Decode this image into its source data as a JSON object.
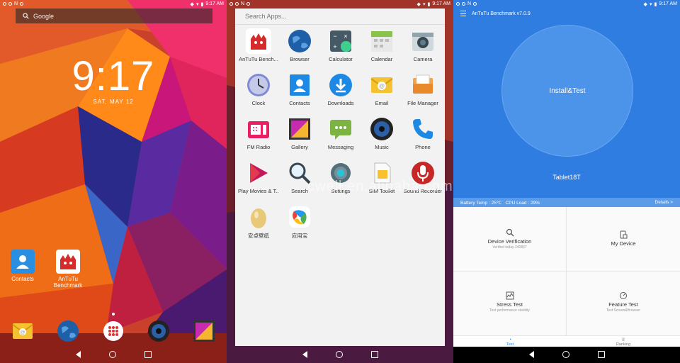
{
  "status": {
    "time": "9:17 AM"
  },
  "home": {
    "search_label": "Google",
    "clock": "9:17",
    "date": "SAT, MAY 12",
    "apps": [
      {
        "label": "Contacts"
      },
      {
        "label": "AnTuTu Benchmark"
      }
    ]
  },
  "drawer": {
    "search_placeholder": "Search Apps...",
    "apps": [
      {
        "label": "AnTuTu Bench...",
        "icon": "antutu-icon"
      },
      {
        "label": "Browser",
        "icon": "globe-icon"
      },
      {
        "label": "Calculator",
        "icon": "calculator-icon"
      },
      {
        "label": "Calendar",
        "icon": "calendar-icon"
      },
      {
        "label": "Camera",
        "icon": "camera-icon"
      },
      {
        "label": "Clock",
        "icon": "clock-icon"
      },
      {
        "label": "Contacts",
        "icon": "contacts-icon"
      },
      {
        "label": "Downloads",
        "icon": "download-icon"
      },
      {
        "label": "Email",
        "icon": "email-icon"
      },
      {
        "label": "File Manager",
        "icon": "file-manager-icon"
      },
      {
        "label": "FM Radio",
        "icon": "radio-icon"
      },
      {
        "label": "Gallery",
        "icon": "gallery-icon"
      },
      {
        "label": "Messaging",
        "icon": "messaging-icon"
      },
      {
        "label": "Music",
        "icon": "music-icon"
      },
      {
        "label": "Phone",
        "icon": "phone-icon"
      },
      {
        "label": "Play Movies & T...",
        "icon": "play-movies-icon"
      },
      {
        "label": "Search",
        "icon": "search-icon"
      },
      {
        "label": "Settings",
        "icon": "settings-icon"
      },
      {
        "label": "SIM Toolkit",
        "icon": "sim-toolkit-icon"
      },
      {
        "label": "Sound Recorder",
        "icon": "microphone-icon"
      },
      {
        "label": "安卓壁纸",
        "icon": "egg-icon"
      },
      {
        "label": "应用宝",
        "icon": "app-store-icon"
      }
    ],
    "watermark": "cwell.en.alibaba.com"
  },
  "antutu": {
    "app_title": "AnTuTu Benchmark v7.0.9",
    "install_label": "Install&Test",
    "device_name": "Tablet18T",
    "battery_temp": "Battery Temp : 25℃",
    "cpu_load": "CPU Load : 29%",
    "details": "Details >",
    "cells": [
      {
        "title": "Device Verification",
        "sub": "Verified today 240847"
      },
      {
        "title": "My Device",
        "sub": ""
      },
      {
        "title": "Stress Test",
        "sub": "Test performance stability"
      },
      {
        "title": "Feature Test",
        "sub": "Test Screen&Browser"
      }
    ],
    "tabs": [
      {
        "label": "Test"
      },
      {
        "label": "Ranking"
      }
    ],
    "accent": "#2f7de1"
  }
}
